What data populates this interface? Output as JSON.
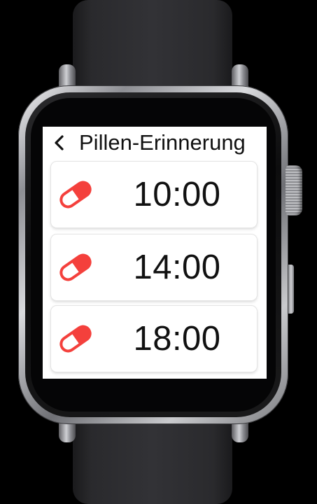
{
  "app": {
    "title": "Pillen-Erinnerung",
    "back_icon": "chevron-left-icon"
  },
  "reminders": [
    {
      "time": "10:00",
      "icon": "pill-icon"
    },
    {
      "time": "14:00",
      "icon": "pill-icon"
    },
    {
      "time": "18:00",
      "icon": "pill-icon"
    }
  ],
  "colors": {
    "pill": "#f4403c",
    "screen_background": "#ffffff",
    "text": "#111111"
  }
}
